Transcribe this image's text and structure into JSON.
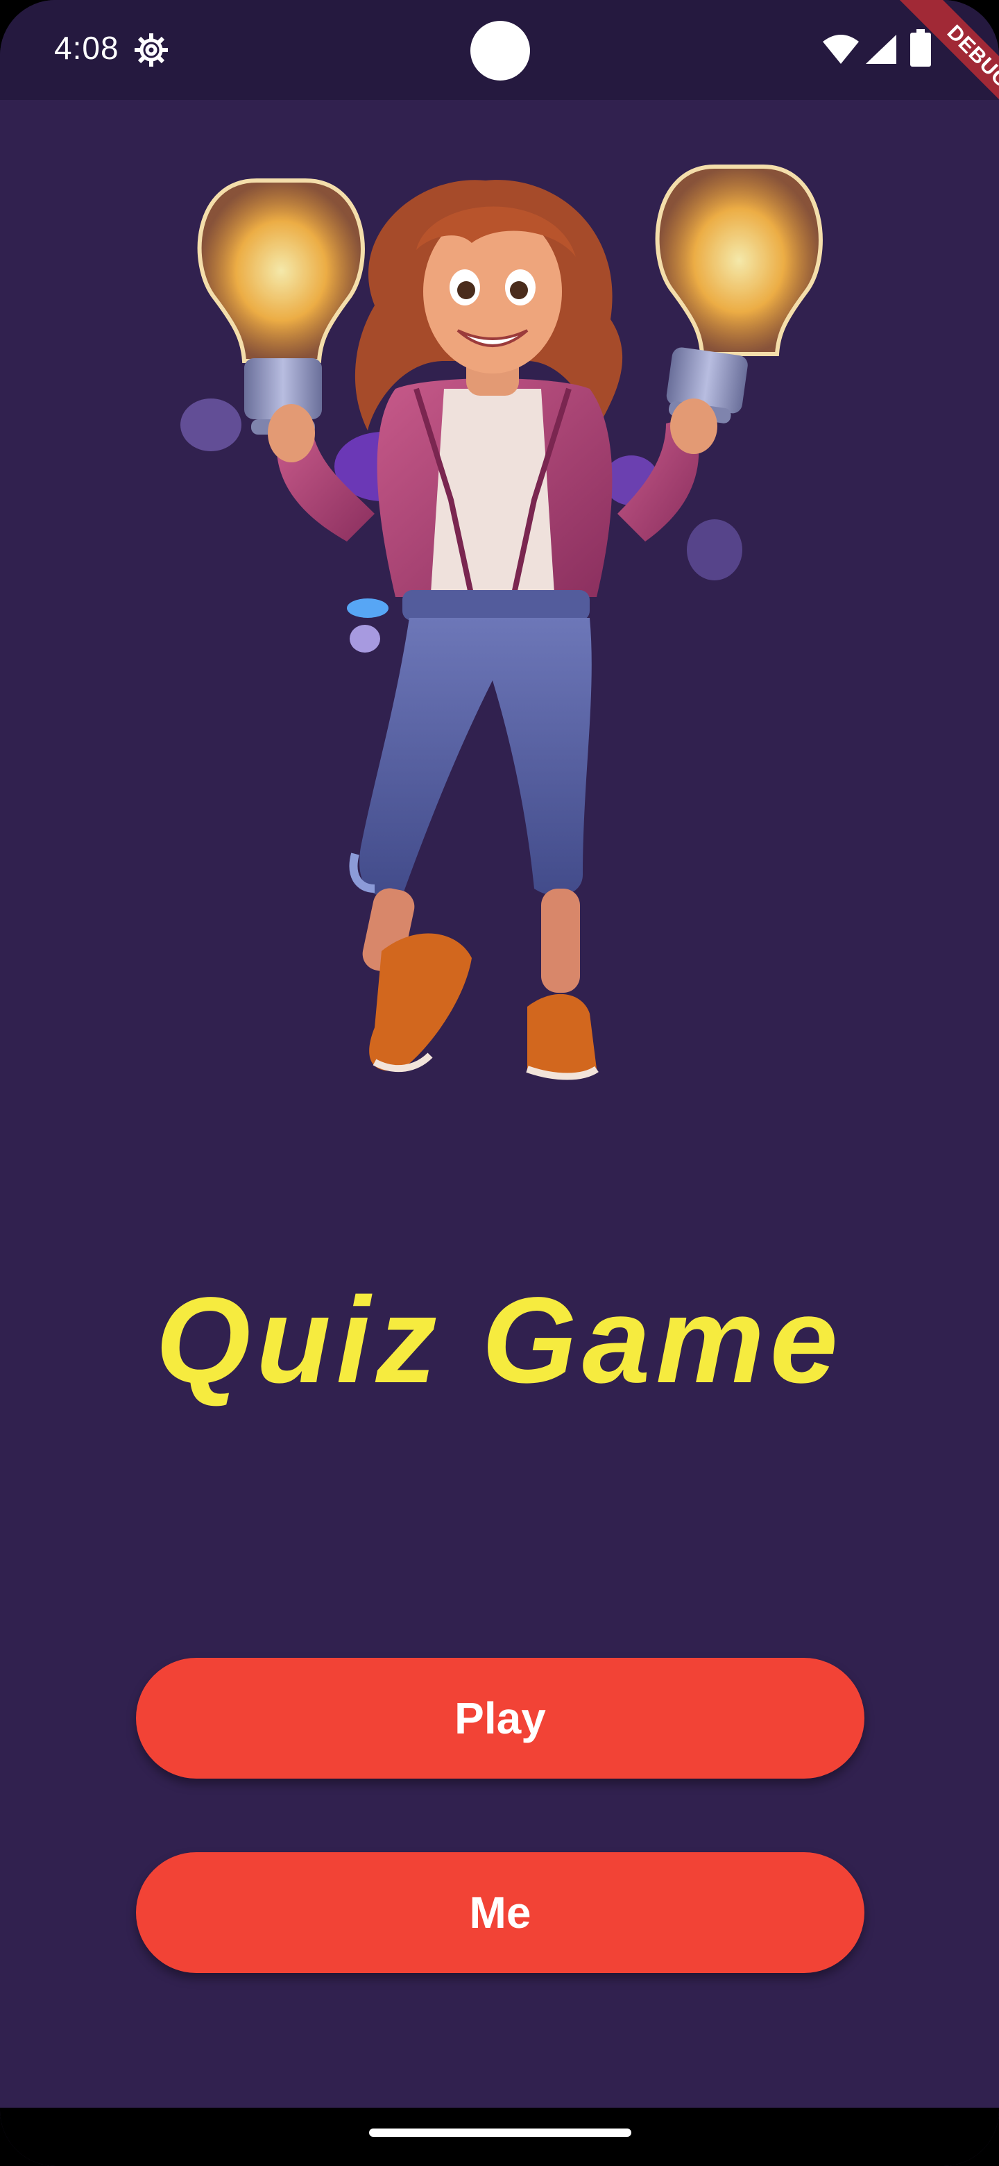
{
  "status_bar": {
    "time": "4:08",
    "icons": [
      "settings-icon",
      "camera-cutout",
      "wifi-icon",
      "signal-icon",
      "battery-icon"
    ]
  },
  "debug_banner": {
    "label": "DEBUG"
  },
  "hero": {
    "image_name": "girl-holding-light-bulbs-illustration"
  },
  "title": "Quiz Game",
  "buttons": {
    "play_label": "Play",
    "me_label": "Me"
  },
  "colors": {
    "background": "#31214f",
    "status_bar": "#25193f",
    "title": "#f6eb3f",
    "button": "#f24336",
    "button_text": "#ffffff"
  }
}
